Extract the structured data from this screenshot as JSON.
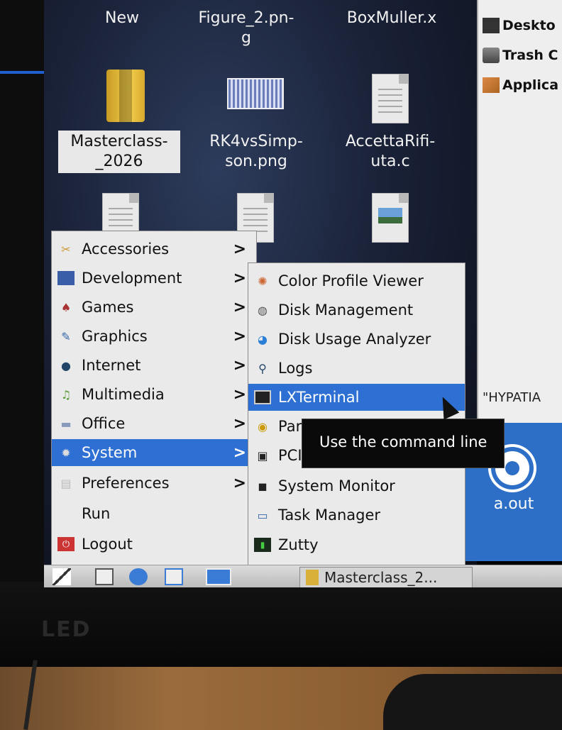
{
  "desktop": {
    "top_labels": [
      "New",
      "Figure_2.pn-\ng",
      "BoxMuller.x"
    ],
    "icons": [
      {
        "label_line1": "Masterclass-",
        "label_line2": "_2026",
        "type": "folder-icon"
      },
      {
        "label_line1": "RK4vsSimp-",
        "label_line2": "son.png",
        "type": "image-icon"
      },
      {
        "label_line1": "AccettaRifi-",
        "label_line2": "uta.c",
        "type": "document-icon"
      }
    ]
  },
  "file_manager": {
    "places": [
      "Deskto",
      "Trash C",
      "Applica"
    ],
    "status_text": "\"HYPATIA"
  },
  "aout": {
    "label": "a.out"
  },
  "main_menu": {
    "items": [
      {
        "label": "Accessories",
        "icon": "accessories-icon",
        "has_submenu": true
      },
      {
        "label": "Development",
        "icon": "development-icon",
        "has_submenu": true
      },
      {
        "label": "Games",
        "icon": "games-icon",
        "has_submenu": true
      },
      {
        "label": "Graphics",
        "icon": "graphics-icon",
        "has_submenu": true
      },
      {
        "label": "Internet",
        "icon": "internet-icon",
        "has_submenu": true
      },
      {
        "label": "Multimedia",
        "icon": "multimedia-icon",
        "has_submenu": true
      },
      {
        "label": "Office",
        "icon": "office-icon",
        "has_submenu": true
      },
      {
        "label": "System",
        "icon": "system-icon",
        "has_submenu": true,
        "highlighted": true
      },
      {
        "label": "Preferences",
        "icon": "preferences-icon",
        "has_submenu": true
      },
      {
        "label": "Run",
        "icon": "run-icon",
        "has_submenu": false
      },
      {
        "label": "Logout",
        "icon": "logout-icon",
        "has_submenu": false
      }
    ],
    "arrow": ">"
  },
  "system_submenu": {
    "items": [
      {
        "label": "Color Profile Viewer",
        "icon": "color-profile-icon"
      },
      {
        "label": "Disk Management",
        "icon": "disk-management-icon"
      },
      {
        "label": "Disk Usage Analyzer",
        "icon": "disk-usage-icon"
      },
      {
        "label": "Logs",
        "icon": "logs-icon"
      },
      {
        "label": "LXTerminal",
        "icon": "terminal-icon",
        "highlighted": true
      },
      {
        "label": "Par",
        "icon": "partition-icon"
      },
      {
        "label": "PCI",
        "icon": "pci-icon"
      },
      {
        "label": "System Monitor",
        "icon": "system-monitor-icon"
      },
      {
        "label": "Task Manager",
        "icon": "task-manager-icon"
      },
      {
        "label": "Zutty",
        "icon": "zutty-icon"
      }
    ]
  },
  "tooltip": {
    "text": "Use the command line"
  },
  "taskbar": {
    "task_label": "Masterclass_2..."
  },
  "colors": {
    "highlight": "#2d6fd2",
    "menu_bg": "#eaeaea",
    "tooltip_bg": "#0a0a0a"
  }
}
